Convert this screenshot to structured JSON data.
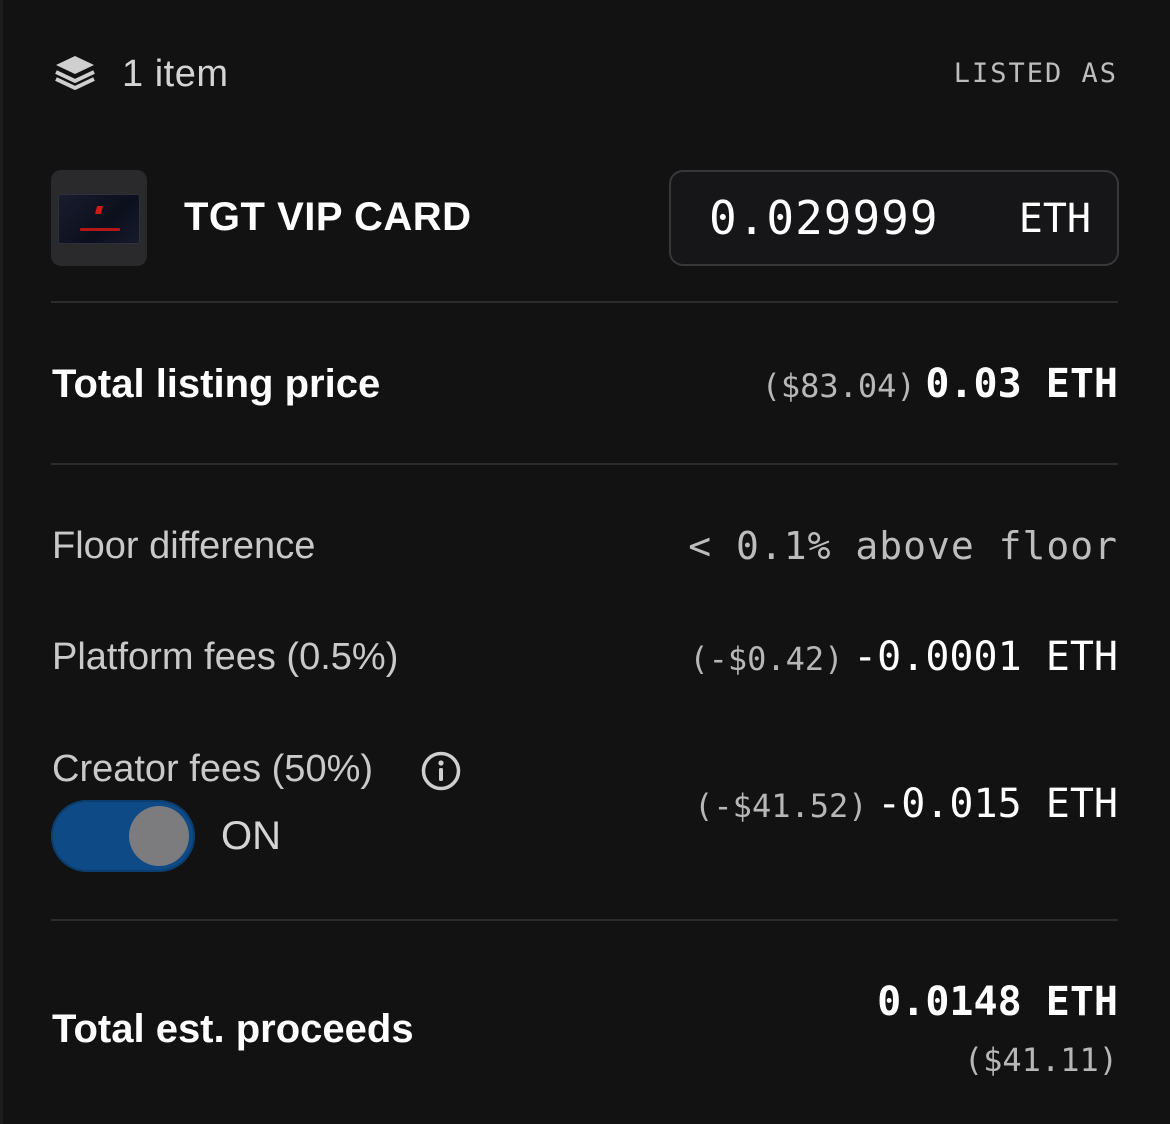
{
  "header": {
    "icon": "layers-icon",
    "item_count": "1 item",
    "listed_as": "LISTED AS"
  },
  "item": {
    "name": "TGT VIP CARD",
    "thumbnail": "nft-thumbnail",
    "price_value": "0.029999",
    "price_unit": "ETH"
  },
  "total_listing": {
    "label": "Total listing price",
    "usd": "($83.04)",
    "eth": "0.03 ETH"
  },
  "floor": {
    "label": "Floor difference",
    "value": "< 0.1% above floor"
  },
  "platform_fees": {
    "label": "Platform fees (0.5%)",
    "usd": "(-$0.42)",
    "eth": "-0.0001 ETH"
  },
  "creator_fees": {
    "label": "Creator fees (50%)",
    "info_icon": "info-icon",
    "toggle_state": "ON",
    "usd": "(-$41.52)",
    "eth": "-0.015 ETH"
  },
  "proceeds": {
    "label": "Total est. proceeds",
    "eth": "0.0148 ETH",
    "usd": "($41.11)"
  },
  "colors": {
    "background": "#121212",
    "toggle_on": "#0e4a86",
    "divider": "#2c2c2e"
  }
}
